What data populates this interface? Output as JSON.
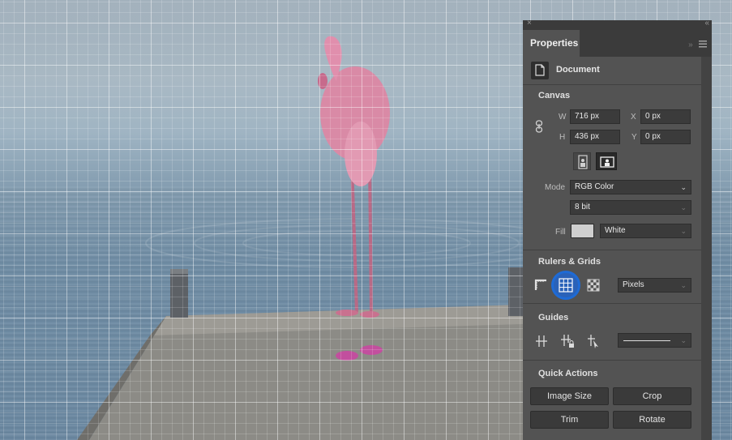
{
  "panel": {
    "tab_title": "Properties",
    "close_glyph": "×",
    "collapse_glyph": "«",
    "menu_icon": "hamburger-menu-icon",
    "section_document": {
      "title": "Document",
      "icon": "document-icon"
    },
    "canvas": {
      "title": "Canvas",
      "w_label": "W",
      "w_value": "716 px",
      "h_label": "H",
      "h_value": "436 px",
      "x_label": "X",
      "x_value": "0 px",
      "y_label": "Y",
      "y_value": "0 px",
      "link_icon": "link-icon",
      "portrait_icon": "portrait-orientation-icon",
      "landscape_icon": "landscape-orientation-icon",
      "mode_label": "Mode",
      "mode_value": "RGB Color",
      "bit_value": "8 bit",
      "fill_label": "Fill",
      "fill_value": "White",
      "fill_color": "#cfcfcf"
    },
    "rulers_grids": {
      "title": "Rulers & Grids",
      "ruler_icon": "ruler-icon",
      "grid_icon": "grid-icon",
      "pixel_grid_icon": "pixel-grid-icon",
      "units_value": "Pixels",
      "highlight_color": "#1e6bd6"
    },
    "guides": {
      "title": "Guides",
      "show_guides_icon": "guides-icon",
      "lock_guides_icon": "lock-guides-icon",
      "smart_guides_icon": "smart-guides-icon",
      "line_style": "solid"
    },
    "quick_actions": {
      "title": "Quick Actions",
      "image_size": "Image Size",
      "crop": "Crop",
      "trim": "Trim",
      "rotate": "Rotate"
    }
  },
  "colors": {
    "panel_bg": "#535353",
    "field_bg": "#3b3b3b",
    "accent": "#1e6bd6"
  }
}
